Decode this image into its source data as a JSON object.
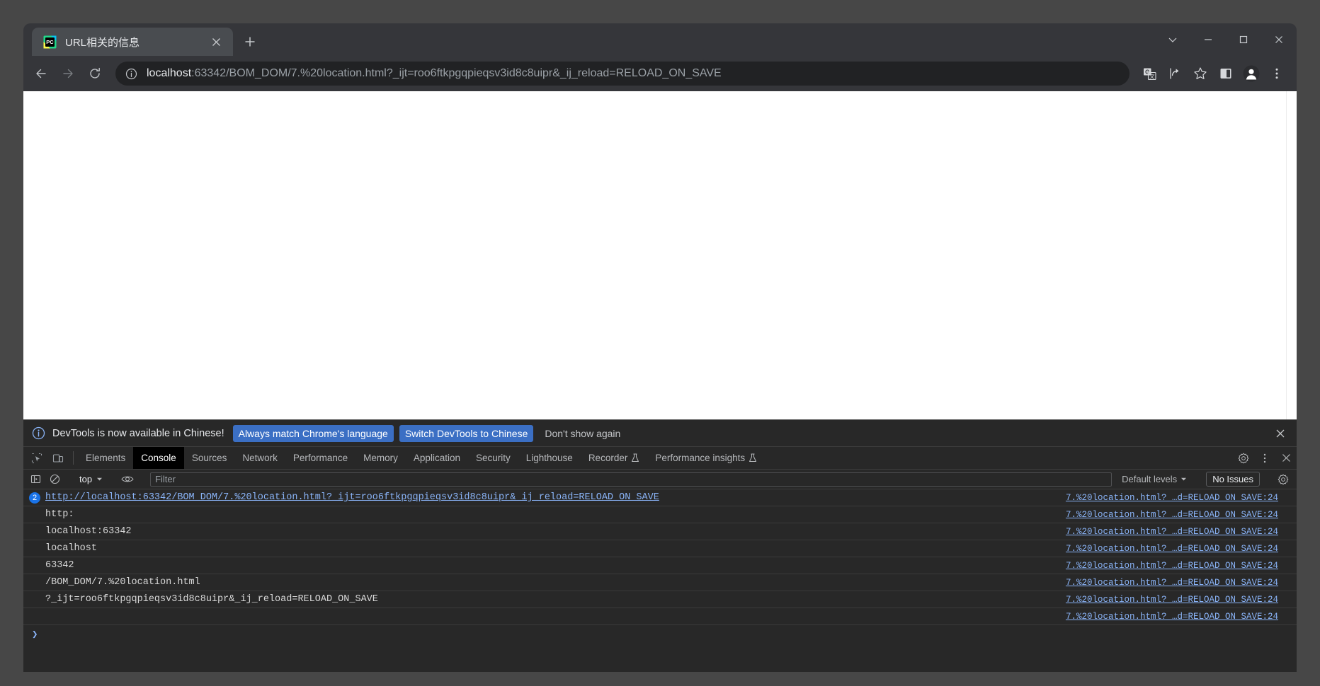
{
  "window": {
    "controls": [
      {
        "name": "minimize-to-tray",
        "glyph": "chevron-down"
      },
      {
        "name": "minimize",
        "glyph": "minimize"
      },
      {
        "name": "maximize",
        "glyph": "maximize"
      },
      {
        "name": "close",
        "glyph": "close"
      }
    ]
  },
  "tab": {
    "title": "URL相关的信息",
    "close_label": "✕",
    "new_tab_label": "+"
  },
  "toolbar": {
    "back_label": "←",
    "forward_label": "→",
    "reload_label": "⟳",
    "url_host": "localhost",
    "url_rest": ":63342/BOM_DOM/7.%20location.html?_ijt=roo6ftkpgqpieqsv3id8c8uipr&_ij_reload=RELOAD_ON_SAVE",
    "icons": [
      "translate-icon",
      "share-icon",
      "bookmark-star-icon",
      "side-panel-icon",
      "profile-icon",
      "chrome-menu-icon"
    ]
  },
  "devtools": {
    "infobar": {
      "message": "DevTools is now available in Chinese!",
      "primary_button": "Always match Chrome's language",
      "secondary_button": "Switch DevTools to Chinese",
      "dismiss_button": "Don't show again"
    },
    "tabs": [
      {
        "label": "Elements",
        "active": false,
        "flask": false
      },
      {
        "label": "Console",
        "active": true,
        "flask": false
      },
      {
        "label": "Sources",
        "active": false,
        "flask": false
      },
      {
        "label": "Network",
        "active": false,
        "flask": false
      },
      {
        "label": "Performance",
        "active": false,
        "flask": false
      },
      {
        "label": "Memory",
        "active": false,
        "flask": false
      },
      {
        "label": "Application",
        "active": false,
        "flask": false
      },
      {
        "label": "Security",
        "active": false,
        "flask": false
      },
      {
        "label": "Lighthouse",
        "active": false,
        "flask": false
      },
      {
        "label": "Recorder",
        "active": false,
        "flask": true
      },
      {
        "label": "Performance insights",
        "active": false,
        "flask": true
      }
    ],
    "console_toolbar": {
      "context": "top",
      "filter_placeholder": "Filter",
      "filter_value": "",
      "levels": "Default levels",
      "issues": "No Issues"
    },
    "console_rows": [
      {
        "badge": "2",
        "text": "http://localhost:63342/BOM_DOM/7.%20location.html?_ijt=roo6ftkpgqpieqsv3id8c8uipr&_ij_reload=RELOAD_ON_SAVE",
        "is_link": true,
        "source": "7.%20location.html?_…d=RELOAD_ON_SAVE:24"
      },
      {
        "badge": "",
        "text": "http:",
        "is_link": false,
        "source": "7.%20location.html?_…d=RELOAD_ON_SAVE:24"
      },
      {
        "badge": "",
        "text": "localhost:63342",
        "is_link": false,
        "source": "7.%20location.html?_…d=RELOAD_ON_SAVE:24"
      },
      {
        "badge": "",
        "text": "localhost",
        "is_link": false,
        "source": "7.%20location.html?_…d=RELOAD_ON_SAVE:24"
      },
      {
        "badge": "",
        "text": "63342",
        "is_link": false,
        "source": "7.%20location.html?_…d=RELOAD_ON_SAVE:24"
      },
      {
        "badge": "",
        "text": "/BOM_DOM/7.%20location.html",
        "is_link": false,
        "source": "7.%20location.html?_…d=RELOAD_ON_SAVE:24"
      },
      {
        "badge": "",
        "text": "?_ijt=roo6ftkpgqpieqsv3id8c8uipr&_ij_reload=RELOAD_ON_SAVE",
        "is_link": false,
        "source": "7.%20location.html?_…d=RELOAD_ON_SAVE:24"
      },
      {
        "badge": "",
        "text": "",
        "is_link": false,
        "source": "7.%20location.html?_…d=RELOAD_ON_SAVE:24"
      }
    ],
    "prompt_symbol": "❯"
  },
  "colors": {
    "accent": "#1a73e8",
    "link": "#8ab4f8",
    "devtools_bg": "#282828",
    "chrome_bg": "#35363a",
    "button_blue": "#3b6fc4"
  }
}
